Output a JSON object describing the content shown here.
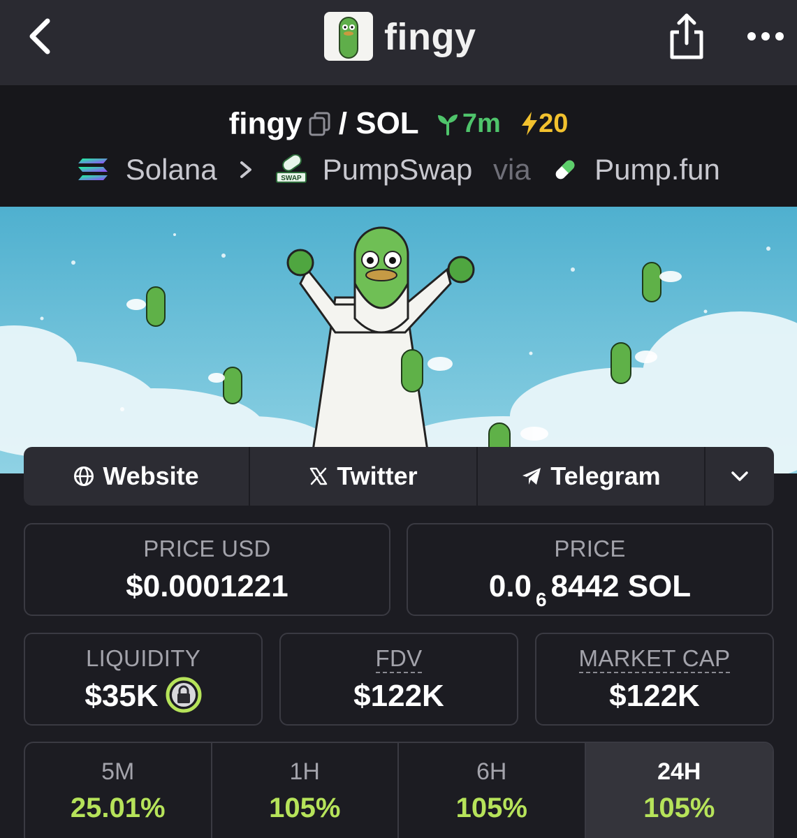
{
  "nav": {
    "title": "fingy",
    "back_icon": "chevron-left-icon",
    "share_icon": "share-icon",
    "more_icon": "more-dots-icon"
  },
  "pair": {
    "base": "fingy",
    "separator": "/",
    "quote": "SOL",
    "age": "7m",
    "boosts": "20",
    "chain": "Solana",
    "dex": "PumpSwap",
    "via": "via",
    "launchpad": "Pump.fun",
    "age_color": "#4fc46b",
    "boost_color": "#f2c12e"
  },
  "socials": {
    "website": "Website",
    "twitter": "Twitter",
    "telegram": "Telegram"
  },
  "stats": {
    "price_usd_label": "PRICE USD",
    "price_usd_value": "$0.0001221",
    "price_label": "PRICE",
    "price_prefix": "0.0",
    "price_zeros": "6",
    "price_suffix": "8442 SOL",
    "liquidity_label": "LIQUIDITY",
    "liquidity_value": "$35K",
    "fdv_label": "FDV",
    "fdv_value": "$122K",
    "mcap_label": "MARKET CAP",
    "mcap_value": "$122K"
  },
  "tabs": [
    {
      "label": "5M",
      "value": "25.01%"
    },
    {
      "label": "1H",
      "value": "105%"
    },
    {
      "label": "6H",
      "value": "105%"
    },
    {
      "label": "24H",
      "value": "105%"
    }
  ],
  "colors": {
    "positive": "#b6e35a",
    "background": "#1c1c22"
  }
}
